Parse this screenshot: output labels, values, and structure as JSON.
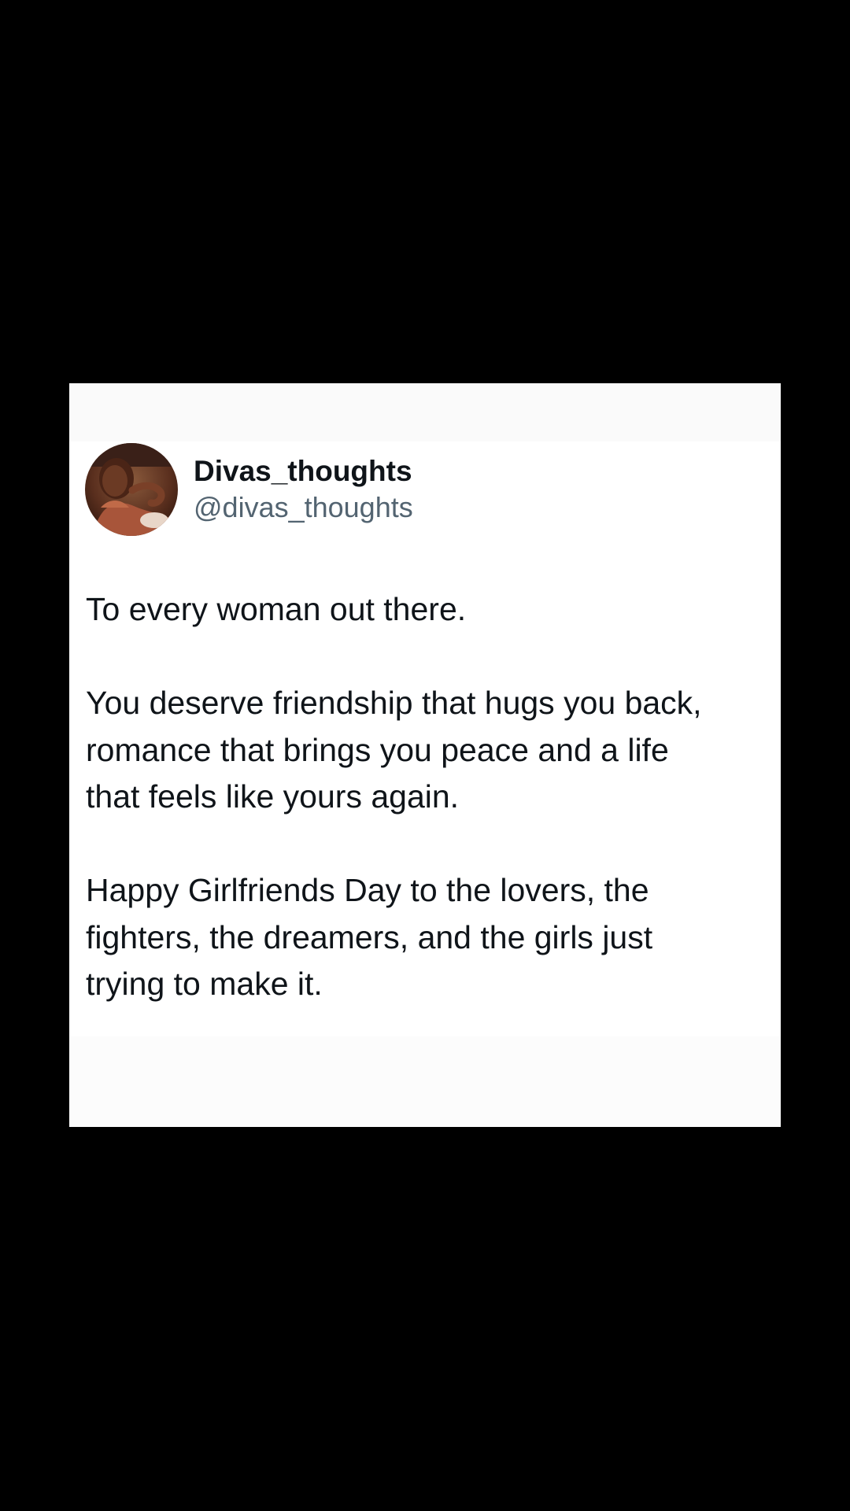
{
  "post": {
    "author": {
      "display_name": "Divas_thoughts",
      "handle": "@divas_thoughts",
      "avatar_icon": "profile-photo"
    },
    "paragraphs": [
      "To every woman out there.",
      "You deserve friendship that hugs you back,\nromance that brings you peace and a life\nthat feels like yours again.",
      "Happy Girlfriends Day to the lovers, the\nfighters, the dreamers, and the girls just\ntrying to make it."
    ]
  },
  "colors": {
    "background": "#000000",
    "card": "#ffffff",
    "text_primary": "#0f1419",
    "text_secondary": "#536471"
  }
}
